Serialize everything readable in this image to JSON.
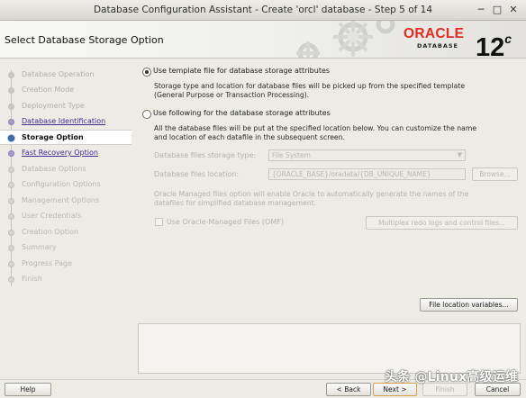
{
  "window": {
    "title": "Database Configuration Assistant - Create 'orcl' database - Step 5 of 14",
    "controls": [
      "─",
      "□",
      "✕"
    ]
  },
  "header": {
    "page_title": "Select Database Storage Option",
    "brand": "ORACLE",
    "brand_sub": "DATABASE",
    "version": "12",
    "version_suffix": "c"
  },
  "nav": {
    "items": [
      {
        "label": "Database Operation",
        "state": "done"
      },
      {
        "label": "Creation Mode",
        "state": "done"
      },
      {
        "label": "Deployment Type",
        "state": "done"
      },
      {
        "label": "Database Identification",
        "state": "link"
      },
      {
        "label": "Storage Option",
        "state": "current"
      },
      {
        "label": "Fast Recovery Option",
        "state": "link"
      },
      {
        "label": "Database Options",
        "state": "upcoming"
      },
      {
        "label": "Configuration Options",
        "state": "upcoming"
      },
      {
        "label": "Management Options",
        "state": "upcoming"
      },
      {
        "label": "User Credentials",
        "state": "upcoming"
      },
      {
        "label": "Creation Option",
        "state": "upcoming"
      },
      {
        "label": "Summary",
        "state": "upcoming"
      },
      {
        "label": "Progress Page",
        "state": "upcoming"
      },
      {
        "label": "Finish",
        "state": "upcoming"
      }
    ]
  },
  "storage": {
    "option_template_label": "Use template file for database storage attributes",
    "option_template_desc_1": "Storage type and location for database files will be picked up from the specified template",
    "option_template_desc_2": "(General Purpose or Transaction Processing).",
    "option_custom_label": "Use following for the database storage attributes",
    "option_custom_desc_1": "All the database files will be put at the specified location below. You can customize the name",
    "option_custom_desc_2": "and location of each datafile in the subsequent screen.",
    "storage_type_label": "Database files storage type:",
    "storage_type_value": "File System",
    "location_label": "Database files location:",
    "location_value": "{ORACLE_BASE}/oradata/{DB_UNIQUE_NAME}",
    "browse_label": "Browse...",
    "omf_note_1": "Oracle Managed files option will enable Oracle to automatically generate the names of the",
    "omf_note_2": "datafiles for simplified database management.",
    "omf_checkbox_label": "Use Oracle-Managed Files (OMF)",
    "multiplex_label": "Multiplex redo logs and control files...",
    "file_location_variables_label": "File location variables..."
  },
  "footer": {
    "help_label": "Help",
    "back_label": "< Back",
    "next_label": "Next >",
    "finish_label": "Finish",
    "cancel_label": "Cancel"
  },
  "watermark": "头条 @Linux高级运维"
}
